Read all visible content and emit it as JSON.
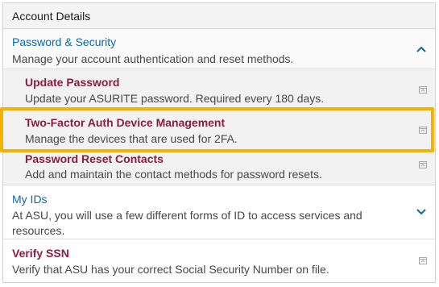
{
  "header": {
    "title": "Account Details"
  },
  "password_security": {
    "title": "Password & Security",
    "description": "Manage your account authentication and reset methods.",
    "items": [
      {
        "title": "Update Password",
        "description": "Update your ASURITE password. Required every 180 days."
      },
      {
        "title": "Two-Factor Auth Device Management",
        "description": "Manage the devices that are used for 2FA."
      },
      {
        "title": "Password Reset Contacts",
        "description": "Add and maintain the contact methods for password resets."
      }
    ]
  },
  "my_ids": {
    "title": "My IDs",
    "description": "At ASU, you will use a few different forms of ID to access services and resources."
  },
  "verify_ssn": {
    "title": "Verify SSN",
    "description": "Verify that ASU has your correct Social Security Number on file."
  },
  "colors": {
    "link_blue": "#0b6aa8",
    "maroon": "#8c1d40",
    "highlight": "#f2b400"
  },
  "icons": {
    "collapse": "chevron-up-icon",
    "expand": "chevron-down-icon",
    "open": "open-in-panel-icon"
  }
}
